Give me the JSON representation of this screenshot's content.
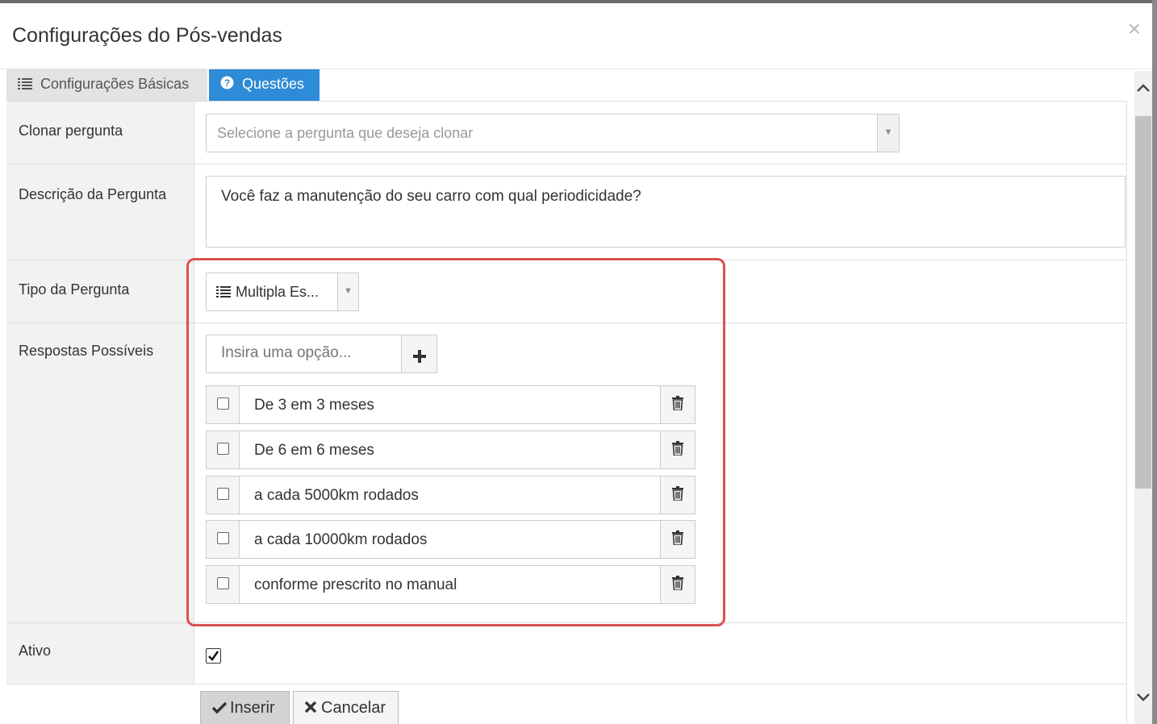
{
  "modal": {
    "title": "Configurações do Pós-vendas",
    "close": "×"
  },
  "tabs": [
    {
      "label": "Configurações Básicas",
      "icon": "list-icon",
      "active": false
    },
    {
      "label": "Questões",
      "icon": "question-circle-icon",
      "active": true
    }
  ],
  "form": {
    "clone_label": "Clonar pergunta",
    "clone_placeholder": "Selecione a pergunta que deseja clonar",
    "description_label": "Descrição da Pergunta",
    "description_value": "Você faz a manutenção do seu carro com qual periodicidade?",
    "type_label": "Tipo da Pergunta",
    "type_value": "Multipla Es...",
    "answers_label": "Respostas Possíveis",
    "option_placeholder": "Insira uma opção...",
    "options": [
      {
        "text": "De 3 em 3 meses",
        "checked": false
      },
      {
        "text": "De 6 em 6 meses",
        "checked": false
      },
      {
        "text": "a cada 5000km rodados",
        "checked": false
      },
      {
        "text": "a cada 10000km rodados",
        "checked": false
      },
      {
        "text": "conforme prescrito no manual",
        "checked": false
      }
    ],
    "active_label": "Ativo",
    "active_checked": true
  },
  "buttons": {
    "insert": "Inserir",
    "cancel": "Cancelar"
  },
  "colors": {
    "active_tab": "#2d8bd7",
    "highlight": "#d9534f"
  }
}
